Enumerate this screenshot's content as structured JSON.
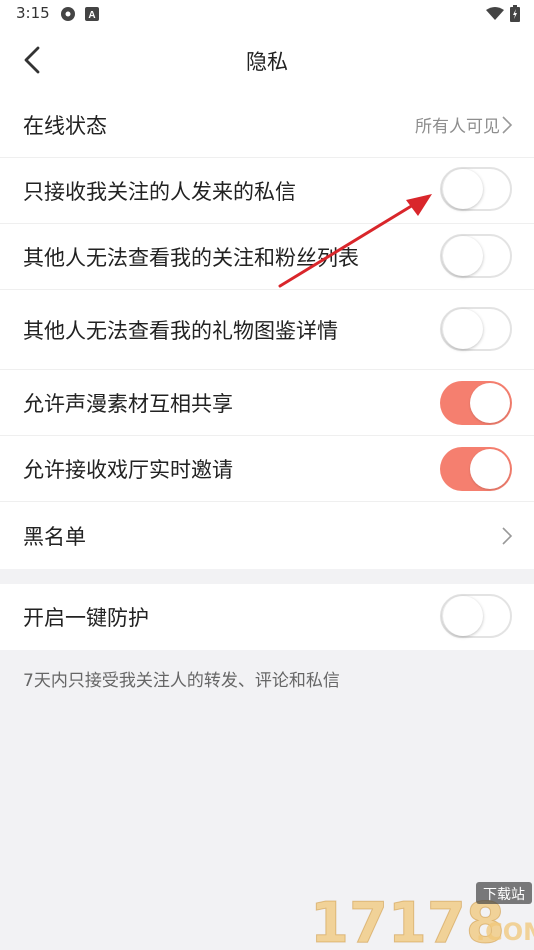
{
  "status_bar": {
    "time": "3:15",
    "icons": [
      "settings-gear-icon",
      "app-a-icon",
      "wifi-icon",
      "battery-icon"
    ]
  },
  "header": {
    "title": "隐私",
    "back_icon": "chevron-left-icon"
  },
  "rows": [
    {
      "label": "在线状态",
      "value": "所有人可见"
    },
    {
      "label": "只接收我关注的人发来的私信",
      "toggle": "off"
    },
    {
      "label": "其他人无法查看我的关注和粉丝列表",
      "toggle": "off"
    },
    {
      "label": "其他人无法查看我的礼物图鉴详情",
      "toggle": "off"
    },
    {
      "label": "允许声漫素材互相共享",
      "toggle": "on"
    },
    {
      "label": "允许接收戏厅实时邀请",
      "toggle": "on"
    },
    {
      "label": "黑名单"
    }
  ],
  "protection": {
    "label": "开启一键防护",
    "toggle": "off",
    "hint": "7天内只接受我关注人的转发、评论和私信"
  },
  "colors": {
    "accent": "#f57f6f",
    "background": "#f2f2f4",
    "annotation_arrow": "#d9262b"
  },
  "watermark": {
    "brand": "17178",
    "domain": ".COM",
    "tag": "下载站"
  }
}
